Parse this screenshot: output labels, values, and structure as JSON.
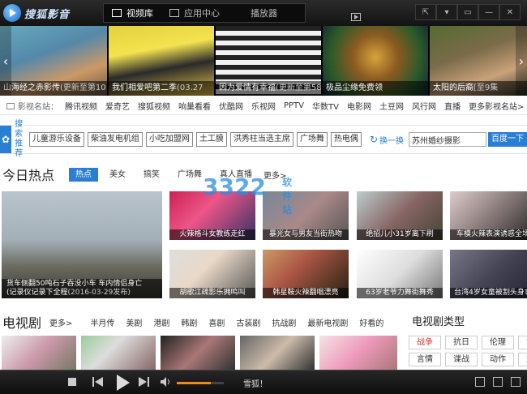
{
  "app": {
    "name": "搜狐影音"
  },
  "nav_tabs": [
    {
      "label": "视频库",
      "active": true
    },
    {
      "label": "应用中心",
      "active": false
    },
    {
      "label": "播放器",
      "active": false
    }
  ],
  "window_buttons": [
    "skin-icon",
    "menu-icon",
    "minimize-icon",
    "maximize-icon",
    "close-icon"
  ],
  "banner": [
    {
      "title": "山海经之赤影传",
      "sub": "(更新至第10"
    },
    {
      "title": "我们相爱吧第二季",
      "sub": "(03.27"
    },
    {
      "title": "因为爱情有幸福",
      "sub": "(更新至第58"
    },
    {
      "title": "极品尘缘免费领",
      "sub": ""
    },
    {
      "title": "太阳的后裔",
      "sub": "[至9集"
    }
  ],
  "sites": {
    "label": "影视名站：",
    "items": [
      "腾讯视频",
      "爱奇艺",
      "搜狐视频",
      "响巢看看",
      "优酷网",
      "乐视网",
      "PPTV",
      "华数TV",
      "电影网",
      "土豆网",
      "风行网",
      "直播",
      "更多影视名站>"
    ]
  },
  "search": {
    "rec_label": "搜索推荐",
    "chips": [
      "儿童游乐设备",
      "柴油发电机组",
      "小吃加盟网",
      "土工膜",
      "洪秀柱当选主席",
      "广场舞",
      "热电偶"
    ],
    "refresh": "换一换",
    "input_value": "苏州婚纱摄影",
    "button": "百度一下"
  },
  "hot": {
    "title": "今日热点",
    "tabs": [
      {
        "label": "热点",
        "active": true
      },
      {
        "label": "美女",
        "active": false
      },
      {
        "label": "搞笑",
        "active": false
      },
      {
        "label": "广场舞",
        "active": false
      },
      {
        "label": "真人直播",
        "active": false
      }
    ],
    "more": "更多>",
    "main": {
      "caption": "货车侧翻50吨石子吞没小车 车内情侣身亡",
      "caption2": "(记录仪记录下全程",
      "date": "(2016-03-29发布)"
    },
    "thumbs": [
      {
        "caption": "火辣格斗女教练走红"
      },
      {
        "caption": "暴光女与男友当街热吻"
      },
      {
        "caption": "绝招儿小31岁离下刷"
      },
      {
        "caption": "车模火辣表演诱惑全场"
      },
      {
        "caption": "胡歌江疏影乐拥鸣叫"
      },
      {
        "caption": "韩星鞍火辣翻唱漂亮"
      },
      {
        "caption": "63岁老爷力舞街舞秀"
      },
      {
        "caption": "台湾4岁女童被割头身亡"
      }
    ]
  },
  "watermark": {
    "text": "3322",
    "sub": "软件站"
  },
  "tv": {
    "title": "电视剧",
    "more": "更多>",
    "links": [
      "半月传",
      "美剧",
      "港剧",
      "韩剧",
      "喜剧",
      "古装剧",
      "抗战剧",
      "最新电视剧",
      "好看的"
    ],
    "types_title": "电视剧类型",
    "types": [
      {
        "label": "战争",
        "red": true
      },
      {
        "label": "抗日",
        "red": false
      },
      {
        "label": "伦理",
        "red": false
      },
      {
        "label": "古装",
        "red": true
      },
      {
        "label": "言情",
        "red": false
      },
      {
        "label": "谍战",
        "red": false
      },
      {
        "label": "动作",
        "red": false
      },
      {
        "label": "武侠",
        "red": false
      }
    ]
  },
  "player": {
    "title": "雪狐！",
    "volume": 0.72
  }
}
